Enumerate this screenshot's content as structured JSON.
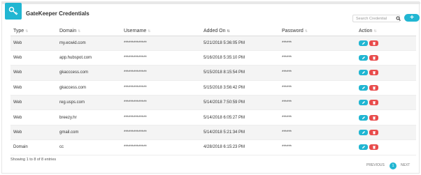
{
  "header": {
    "title": "GateKeeper Credentials",
    "search_placeholder": "Search Credential",
    "add_label": "+"
  },
  "table": {
    "columns": [
      "Type",
      "Domain",
      "Username",
      "Added On",
      "Password",
      "Action"
    ],
    "rows": [
      {
        "type": "Web",
        "domain": "my.ecwid.com",
        "username": "**************",
        "added_on": "5/21/2018 5:36:05 PM",
        "password": "******"
      },
      {
        "type": "Web",
        "domain": "app.hubspot.com",
        "username": "**************",
        "added_on": "5/16/2018 5:35:10 PM",
        "password": "******"
      },
      {
        "type": "Web",
        "domain": "gkacccess.com",
        "username": "**************",
        "added_on": "5/15/2018 8:15:54 PM",
        "password": "******"
      },
      {
        "type": "Web",
        "domain": "gkaccess.com",
        "username": "**************",
        "added_on": "5/15/2018 3:56:42 PM",
        "password": "******"
      },
      {
        "type": "Web",
        "domain": "reg.usps.com",
        "username": "**************",
        "added_on": "5/14/2018 7:50:59 PM",
        "password": "******"
      },
      {
        "type": "Web",
        "domain": "breezy.hr",
        "username": "**************",
        "added_on": "5/14/2018 6:05:27 PM",
        "password": "******"
      },
      {
        "type": "Web",
        "domain": "gmail.com",
        "username": "**************",
        "added_on": "5/14/2018 5:21:34 PM",
        "password": "******"
      },
      {
        "type": "Domain",
        "domain": "cc",
        "username": "**************",
        "added_on": "4/28/2018 6:15:23 PM",
        "password": "******"
      }
    ]
  },
  "footer": {
    "entries_text": "Showing 1 to 8 of 8 entries",
    "previous_label": "PREVIOUS",
    "page": "1",
    "next_label": "NEXT"
  },
  "colors": {
    "accent": "#21b6d2",
    "danger": "#e84b4b"
  },
  "icons": {
    "logo": "key-icon",
    "search": "search-icon",
    "edit": "pencil-icon",
    "delete": "trash-icon"
  }
}
